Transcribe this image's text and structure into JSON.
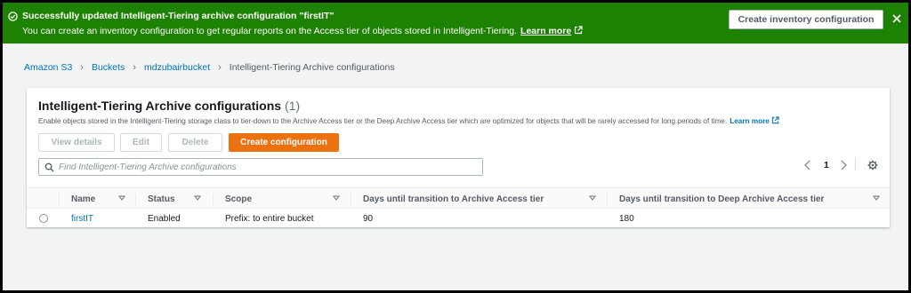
{
  "flash": {
    "title": "Successfully updated Intelligent-Tiering archive configuration \"firstIT\"",
    "description": "You can create an inventory configuration to get regular reports on the Access tier of objects stored in Intelligent-Tiering.",
    "learn_more": "Learn more",
    "action_button": "Create inventory configuration",
    "icon": "check-circle-icon",
    "color": "#1d8102"
  },
  "breadcrumb": {
    "items": [
      "Amazon S3",
      "Buckets",
      "mdzubairbucket",
      "Intelligent-Tiering Archive configurations"
    ]
  },
  "panel": {
    "title": "Intelligent-Tiering Archive configurations",
    "count": "(1)",
    "description": "Enable objects stored in the Intelligent-Tiering storage class to tier-down to the Archive Access tier or the Deep Archive Access tier which are optimized for objects that will be rarely accessed for long periods of time.",
    "learn_more": "Learn more",
    "buttons": {
      "view_details": "View details",
      "edit": "Edit",
      "delete": "Delete",
      "create": "Create configuration"
    },
    "search_placeholder": "Find Intelligent-Tiering Archive configurations",
    "page": "1",
    "accent_color": "#ec7211"
  },
  "table": {
    "columns": [
      "Name",
      "Status",
      "Scope",
      "Days until transition to Archive Access tier",
      "Days until transition to Deep Archive Access tier"
    ],
    "rows": [
      {
        "name": "firstIT",
        "status": "Enabled",
        "scope": "Prefix: to entire bucket",
        "archive_days": "90",
        "deep_archive_days": "180"
      }
    ]
  }
}
